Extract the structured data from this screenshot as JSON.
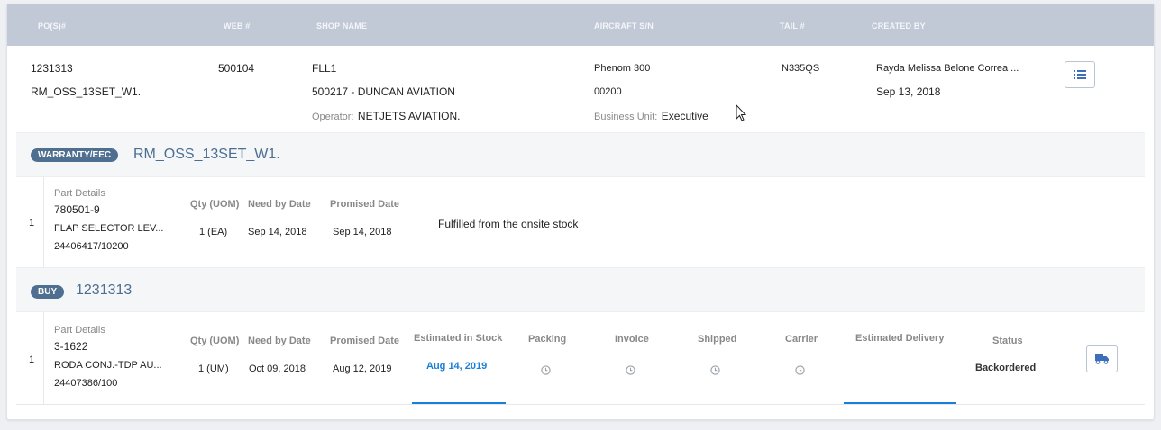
{
  "header": {
    "col_pos": "PO(S)#",
    "col_web": "WEB #",
    "col_shop": "SHOP NAME",
    "col_aircraft": "AIRCRAFT S/N",
    "col_tail": "TAIL #",
    "col_created": "CREATED BY"
  },
  "order": {
    "po": "1231313",
    "po_ref": "RM_OSS_13SET_W1.",
    "web": "500104",
    "shop": "FLL1",
    "shop_detail": "500217 - DUNCAN AVIATION",
    "operator_label": "Operator:",
    "operator": "NETJETS AVIATION.",
    "aircraft": "Phenom 300",
    "serial": "00200",
    "bu_label": "Business Unit:",
    "bu": "Executive",
    "tail": "N335QS",
    "created_by": "Rayda Melissa Belone Correa ...",
    "created_date": "Sep 13, 2018",
    "menu_icon": "list-icon"
  },
  "warranty": {
    "badge": "WARRANTY/EEC",
    "title": "RM_OSS_13SET_W1.",
    "row": {
      "index": "1",
      "part_label": "Part Details",
      "part_number": "780501-9",
      "part_name": "FLAP SELECTOR LEV...",
      "part_ref": "24406417/10200",
      "qty_label": "Qty (UOM)",
      "qty": "1 (EA)",
      "need_label": "Need by Date",
      "need": "Sep 14, 2018",
      "promised_label": "Promised Date",
      "promised": "Sep 14, 2018",
      "note": "Fulfilled from the onsite stock"
    }
  },
  "buy": {
    "badge": "BUY",
    "title": "1231313",
    "row": {
      "index": "1",
      "part_label": "Part Details",
      "part_number": "3-1622",
      "part_name": "RODA CONJ.-TDP AU...",
      "part_ref": "24407386/100",
      "qty_label": "Qty (UOM)",
      "qty": "1 (UM)",
      "need_label": "Need by Date",
      "need": "Oct 09, 2018",
      "promised_label": "Promised Date",
      "promised": "Aug 12, 2019",
      "est_stock_label": "Estimated in Stock",
      "est_stock": "Aug 14, 2019",
      "packing_label": "Packing",
      "invoice_label": "Invoice",
      "shipped_label": "Shipped",
      "carrier_label": "Carrier",
      "est_delivery_label": "Estimated Delivery",
      "status_label": "Status",
      "status": "Backordered",
      "track_icon": "truck-icon",
      "accent": "#1a7fd6"
    }
  }
}
